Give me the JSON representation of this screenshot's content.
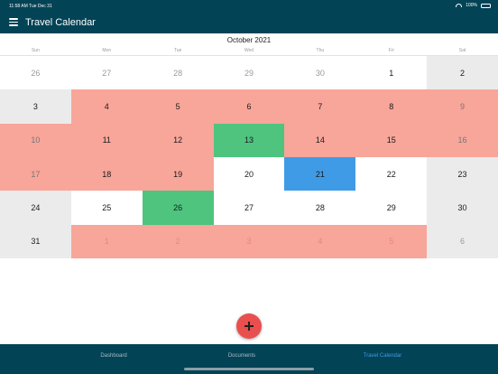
{
  "status": {
    "time": "11:58 AM",
    "date": "Tue Dec 31",
    "battery": "100%"
  },
  "appbar": {
    "title": "Travel Calendar"
  },
  "calendar": {
    "month_title": "October 2021",
    "weekdays": [
      "Sun",
      "Mon",
      "Tue",
      "Wed",
      "Thu",
      "Fri",
      "Sat"
    ],
    "weeks": [
      [
        "26",
        "27",
        "28",
        "29",
        "30",
        "1",
        "2"
      ],
      [
        "3",
        "4",
        "5",
        "6",
        "7",
        "8",
        "9"
      ],
      [
        "10",
        "11",
        "12",
        "13",
        "14",
        "15",
        "16"
      ],
      [
        "17",
        "18",
        "19",
        "20",
        "21",
        "22",
        "23"
      ],
      [
        "24",
        "25",
        "26",
        "27",
        "28",
        "29",
        "30"
      ],
      [
        "31",
        "1",
        "2",
        "3",
        "4",
        "5",
        "6"
      ]
    ],
    "cell_state": [
      [
        "other",
        "other",
        "other",
        "other",
        "other",
        "normal",
        "weekend"
      ],
      [
        "weekend",
        "travel",
        "travel",
        "travel",
        "travel",
        "travel",
        "travel"
      ],
      [
        "travel",
        "travel",
        "travel",
        "green",
        "travel",
        "travel",
        "travel"
      ],
      [
        "travel",
        "travel",
        "travel",
        "normal",
        "blue",
        "normal",
        "weekend"
      ],
      [
        "weekend",
        "normal",
        "green",
        "normal",
        "normal",
        "normal",
        "weekend"
      ],
      [
        "weekend",
        "travel",
        "travel",
        "travel",
        "travel",
        "travel",
        "other-weekend"
      ]
    ],
    "colors": {
      "travel": "#f8a59a",
      "green": "#4ec47e",
      "blue": "#3f9be6",
      "weekend": "#ebebeb"
    }
  },
  "fab": {
    "icon": "plus-icon",
    "color": "#ea4f4f"
  },
  "tabs": [
    {
      "label": "Dashboard",
      "active": false
    },
    {
      "label": "Documents",
      "active": false
    },
    {
      "label": "Travel Calendar",
      "active": true
    }
  ]
}
